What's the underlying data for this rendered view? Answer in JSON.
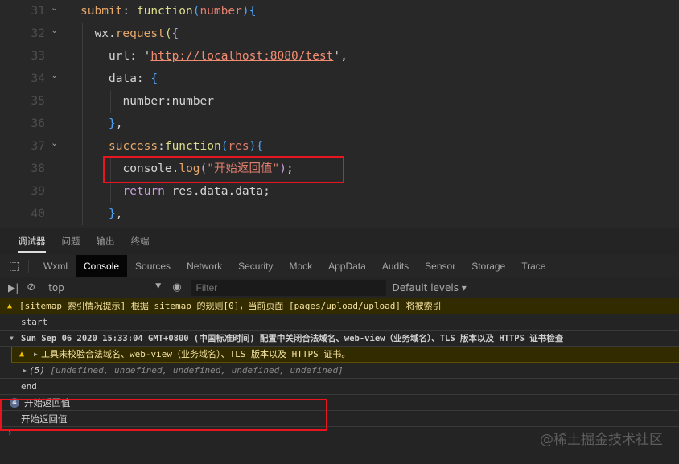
{
  "code": [
    {
      "n": "31",
      "fold": true,
      "indent": 0,
      "tokens": [
        [
          "submit",
          "k-prop"
        ],
        [
          ": ",
          "k-plain"
        ],
        [
          "function",
          "k-fn"
        ],
        [
          "(",
          "k-br2"
        ],
        [
          "number",
          "k-par"
        ],
        [
          ")",
          "k-br2"
        ],
        [
          "{",
          "k-br2"
        ]
      ]
    },
    {
      "n": "32",
      "fold": true,
      "indent": 1,
      "tokens": [
        [
          "wx",
          "k-id"
        ],
        [
          ".",
          "k-plain"
        ],
        [
          "request",
          "k-meth"
        ],
        [
          "(",
          "k-fn"
        ],
        [
          "{",
          "k-br"
        ]
      ]
    },
    {
      "n": "33",
      "fold": false,
      "indent": 2,
      "tokens": [
        [
          "url",
          "k-id"
        ],
        [
          ": '",
          "k-plain"
        ],
        [
          "http://localhost:8080/test",
          "k-url"
        ],
        [
          "',",
          "k-plain"
        ]
      ]
    },
    {
      "n": "34",
      "fold": true,
      "indent": 2,
      "tokens": [
        [
          "data",
          "k-id"
        ],
        [
          ": ",
          "k-plain"
        ],
        [
          "{",
          "k-br2"
        ]
      ]
    },
    {
      "n": "35",
      "fold": false,
      "indent": 3,
      "tokens": [
        [
          "number",
          "k-id"
        ],
        [
          ":",
          "k-plain"
        ],
        [
          "number",
          "k-id"
        ]
      ]
    },
    {
      "n": "36",
      "fold": false,
      "indent": 2,
      "tokens": [
        [
          "}",
          "k-br2"
        ],
        [
          ",",
          "k-plain"
        ]
      ]
    },
    {
      "n": "37",
      "fold": true,
      "indent": 2,
      "tokens": [
        [
          "success",
          "k-prop"
        ],
        [
          ":",
          "k-plain"
        ],
        [
          "function",
          "k-fn"
        ],
        [
          "(",
          "k-br2"
        ],
        [
          "res",
          "k-par"
        ],
        [
          ")",
          "k-br2"
        ],
        [
          "{",
          "k-br2"
        ]
      ]
    },
    {
      "n": "38",
      "fold": false,
      "indent": 3,
      "tokens": [
        [
          "console",
          "k-id"
        ],
        [
          ".",
          "k-plain"
        ],
        [
          "log",
          "k-meth"
        ],
        [
          "(",
          "k-br"
        ],
        [
          "\"开始返回值\"",
          "k-str"
        ],
        [
          ")",
          "k-br"
        ],
        [
          ";",
          "k-plain"
        ]
      ]
    },
    {
      "n": "39",
      "fold": false,
      "indent": 3,
      "tokens": [
        [
          "return ",
          "k-br"
        ],
        [
          "res",
          "k-id"
        ],
        [
          ".",
          "k-plain"
        ],
        [
          "data",
          "k-id"
        ],
        [
          ".",
          "k-plain"
        ],
        [
          "data",
          "k-id"
        ],
        [
          ";",
          "k-plain"
        ]
      ]
    },
    {
      "n": "40",
      "fold": false,
      "indent": 2,
      "tokens": [
        [
          "}",
          "k-br2"
        ],
        [
          ",",
          "k-plain"
        ]
      ]
    }
  ],
  "panel_tabs": [
    "调试器",
    "问题",
    "输出",
    "终端"
  ],
  "devtools_tabs": [
    "Wxml",
    "Console",
    "Sources",
    "Network",
    "Security",
    "Mock",
    "AppData",
    "Audits",
    "Sensor",
    "Storage",
    "Trace"
  ],
  "toolbar": {
    "context": "top",
    "filter_placeholder": "Filter",
    "levels": "Default levels"
  },
  "console": {
    "sitemap_warning": "[sitemap 索引情况提示] 根据 sitemap 的规则[0]，当前页面 [pages/upload/upload] 将被索引",
    "start": "start",
    "group_title": "Sun Sep 06 2020 15:33:04 GMT+0800 (中国标准时间) 配置中关闭合法域名、web-view（业务域名）、TLS 版本以及 HTTPS 证书检查",
    "group_warning": "工具未校验合法域名、web-view（业务域名）、TLS 版本以及 HTTPS 证书。",
    "array_count": "(5)",
    "array_values": "[undefined, undefined, undefined, undefined, undefined]",
    "end": "end",
    "repeat_count": "4",
    "log1": "开始返回值",
    "log2": "开始返回值"
  },
  "watermark": "@稀土掘金技术社区"
}
